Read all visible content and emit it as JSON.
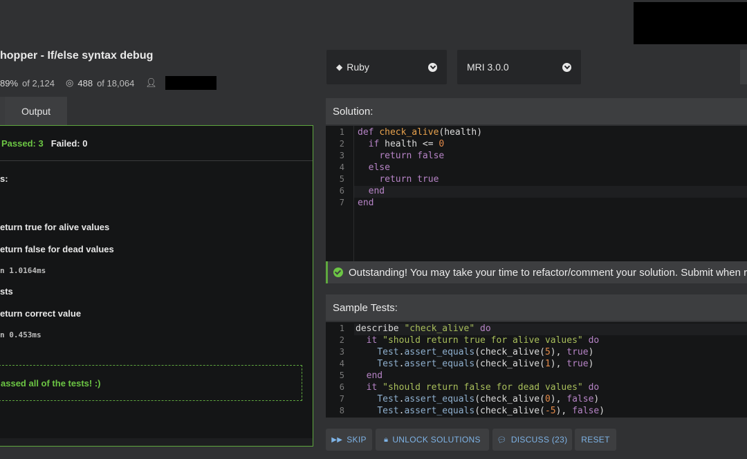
{
  "header": {
    "kata_title": "hopper - If/else syntax debug",
    "stats": {
      "satisfaction": "89%",
      "satisfaction_of": "of 2,124",
      "completed": "488",
      "completed_of": "of 18,064"
    }
  },
  "language_select": {
    "value": "Ruby"
  },
  "version_select": {
    "value": "MRI 3.0.0"
  },
  "left_tabs": {
    "output": "Output"
  },
  "output": {
    "summary_passed": "Passed: 3",
    "summary_failed": "Failed: 0",
    "lines": [
      {
        "text": "s:",
        "kind": "heading"
      },
      {
        "text": "eturn true for alive values",
        "kind": "test"
      },
      {
        "text": "eturn false for dead values",
        "kind": "test"
      },
      {
        "text": "n 1.0164ms",
        "kind": "time"
      },
      {
        "text": "sts",
        "kind": "heading"
      },
      {
        "text": "eturn correct value",
        "kind": "test"
      },
      {
        "text": "n 0.453ms",
        "kind": "time"
      }
    ],
    "success_message": "assed all of the tests! :)"
  },
  "solution": {
    "header": "Solution:",
    "line_numbers": [
      "1",
      "2",
      "3",
      "4",
      "5",
      "6",
      "7"
    ]
  },
  "notice": {
    "text": "Outstanding! You may take your time to refactor/comment your solution. Submit when re"
  },
  "sample_tests": {
    "header": "Sample Tests:",
    "line_numbers": [
      "1",
      "2",
      "3",
      "4",
      "5",
      "6",
      "7",
      "8"
    ]
  },
  "buttons": {
    "skip": "SKIP",
    "unlock": "UNLOCK SOLUTIONS",
    "discuss": "DISCUSS (23)",
    "reset": "RESET"
  },
  "colors": {
    "success": "#6cc644",
    "link": "#7eb3e6"
  }
}
